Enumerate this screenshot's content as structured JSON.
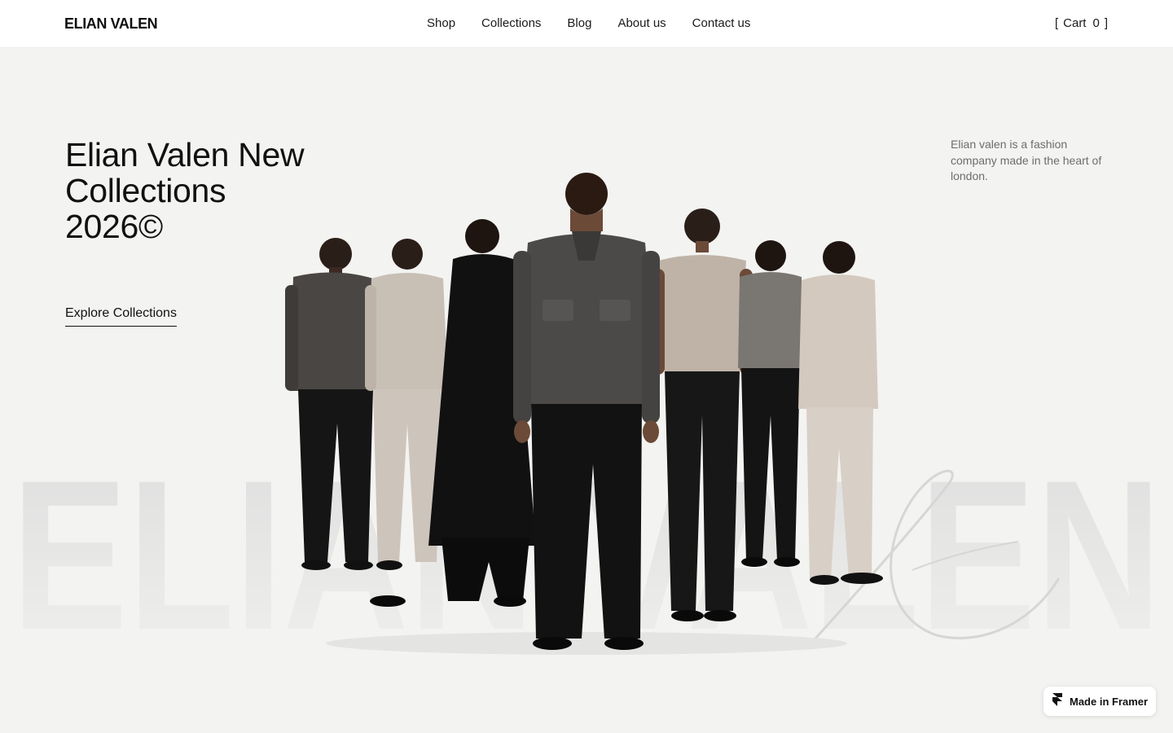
{
  "header": {
    "logo": "ELIAN VALEN",
    "nav": [
      "Shop",
      "Collections",
      "Blog",
      "About us",
      "Contact us"
    ],
    "cart": {
      "open": "[",
      "label": "Cart",
      "count": "0",
      "close": "]"
    }
  },
  "hero": {
    "title_line1": "Elian Valen New",
    "title_line2": "Collections",
    "title_line3": "2026©",
    "cta": "Explore Collections",
    "description": "Elian valen is a fashion company made in the heart of london."
  },
  "watermark": {
    "text": "ELIAN VALEN"
  },
  "badge": {
    "label": "Made in Framer",
    "icon": "framer-icon"
  }
}
